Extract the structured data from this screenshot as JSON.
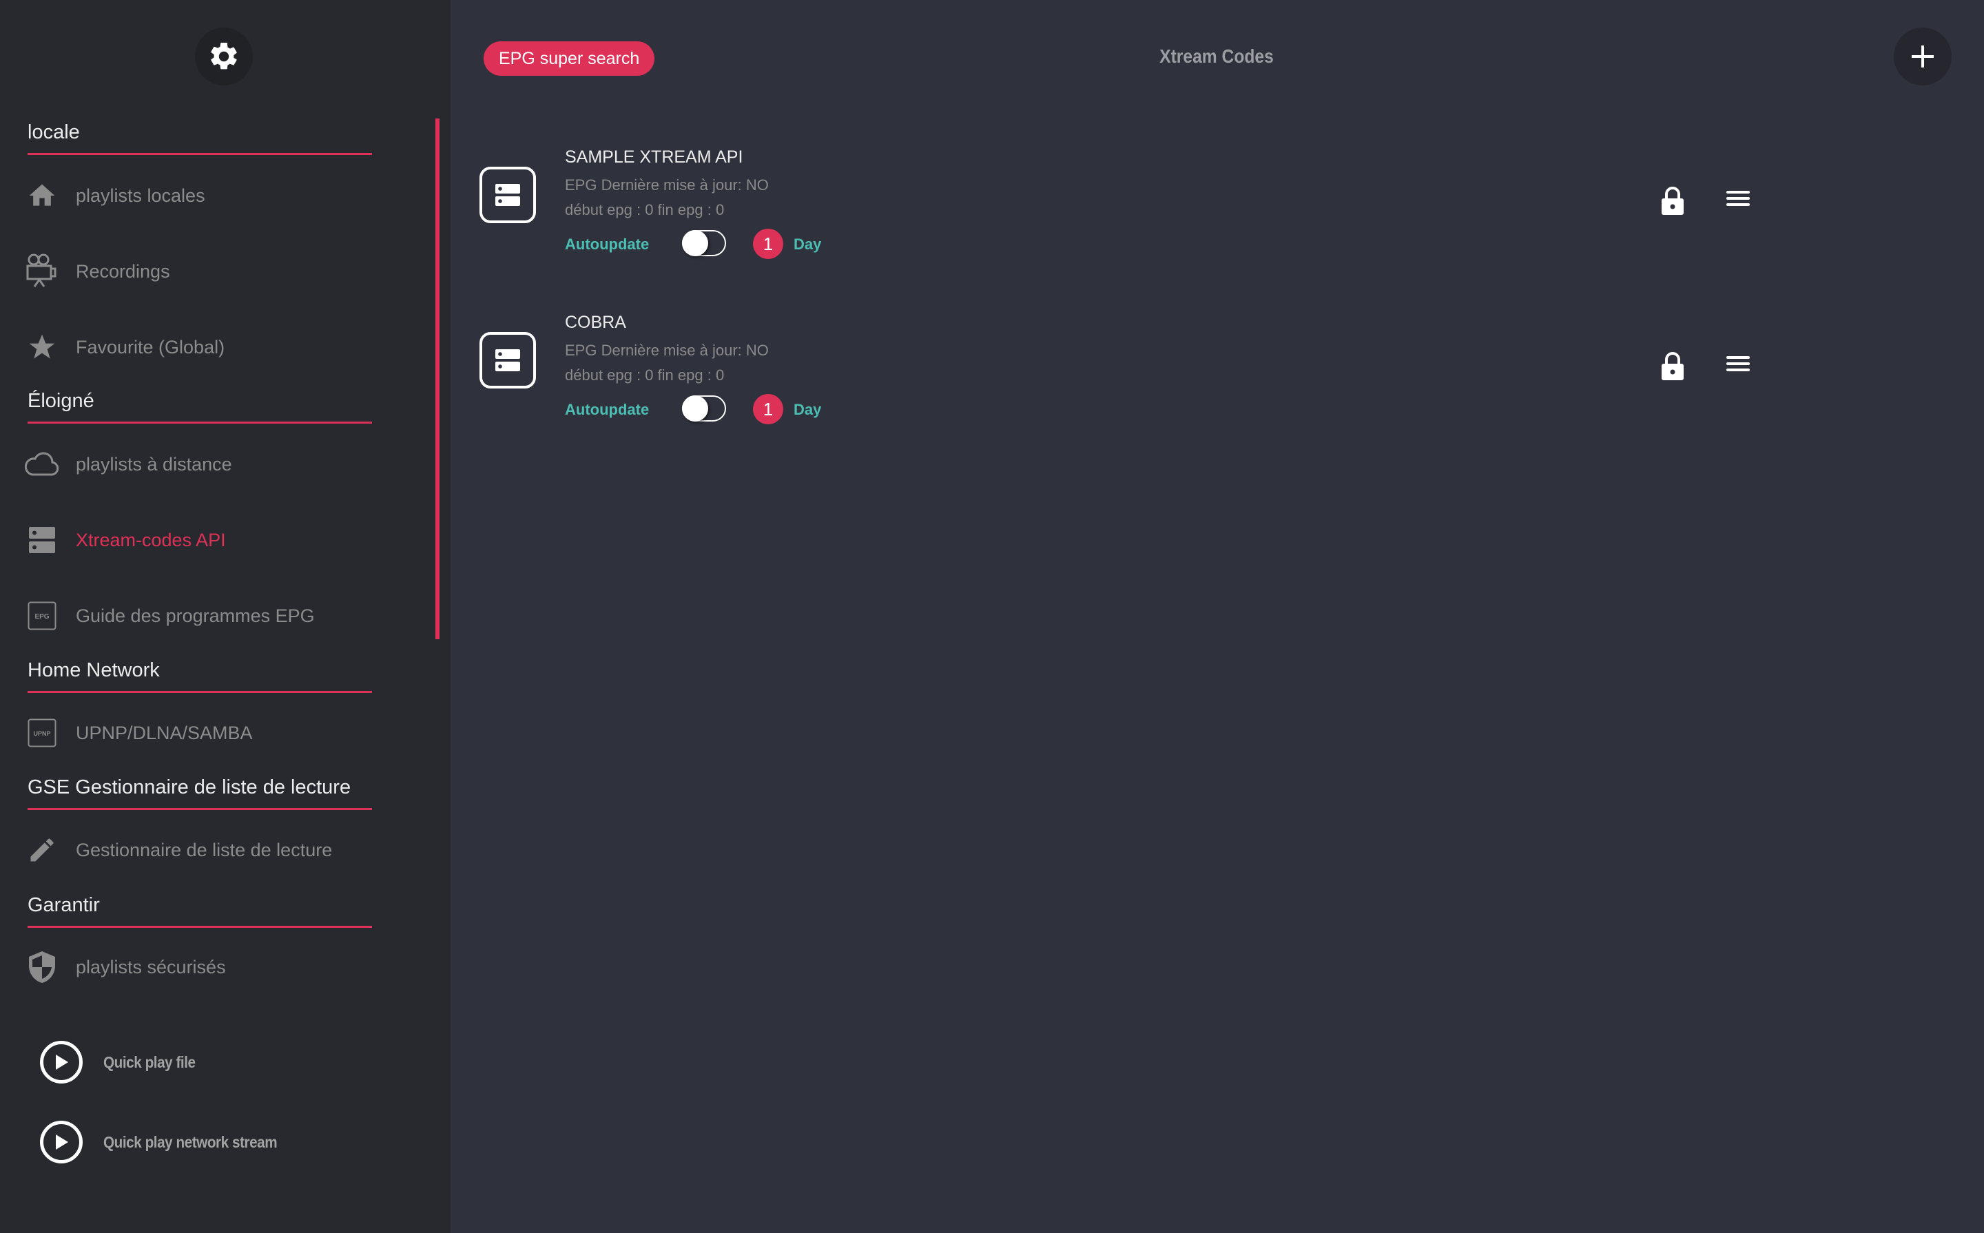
{
  "sidebar": {
    "settings_icon": "gear-icon",
    "sections": [
      {
        "title": "locale",
        "items": [
          {
            "label": "playlists locales",
            "icon": "home-icon"
          },
          {
            "label": "Recordings",
            "icon": "movie-camera-icon"
          },
          {
            "label": "Favourite (Global)",
            "icon": "star-icon"
          }
        ]
      },
      {
        "title": "Éloigné",
        "items": [
          {
            "label": "playlists à distance",
            "icon": "cloud-icon"
          },
          {
            "label": "Xtream-codes API",
            "icon": "server-icon",
            "active": true
          },
          {
            "label": "Guide des programmes EPG",
            "icon": "epg-icon",
            "icon_text": "EPG"
          }
        ]
      },
      {
        "title": "Home Network",
        "items": [
          {
            "label": "UPNP/DLNA/SAMBA",
            "icon": "upnp-icon",
            "icon_text": "UPNP"
          }
        ]
      },
      {
        "title": "GSE Gestionnaire de liste de lecture",
        "items": [
          {
            "label": "Gestionnaire de liste de lecture",
            "icon": "pencil-icon"
          }
        ]
      },
      {
        "title": "Garantir",
        "items": [
          {
            "label": "playlists sécurisés",
            "icon": "shield-icon"
          }
        ]
      }
    ],
    "quick_play": [
      {
        "label": "Quick play file",
        "icon": "play-circle-icon"
      },
      {
        "label": "Quick play network stream",
        "icon": "play-circle-icon"
      }
    ]
  },
  "header": {
    "epg_button": "EPG super search",
    "title": "Xtream Codes",
    "add_icon": "plus-icon"
  },
  "playlists": [
    {
      "name": "SAMPLE XTREAM API",
      "epg_last_update": "EPG Dernière mise à jour: NO",
      "epg_range": "début epg : 0 fin epg : 0",
      "autoupdate_label": "Autoupdate",
      "autoupdate_on": false,
      "interval_value": "1",
      "interval_unit": "Day"
    },
    {
      "name": "COBRA",
      "epg_last_update": "EPG Dernière mise à jour: NO",
      "epg_range": "début epg : 0 fin epg : 0",
      "autoupdate_label": "Autoupdate",
      "autoupdate_on": false,
      "interval_value": "1",
      "interval_unit": "Day"
    }
  ],
  "colors": {
    "accent": "#de3157",
    "teal": "#4cbfb4",
    "sidebar_bg": "#28292e",
    "main_bg": "#2f313c"
  }
}
